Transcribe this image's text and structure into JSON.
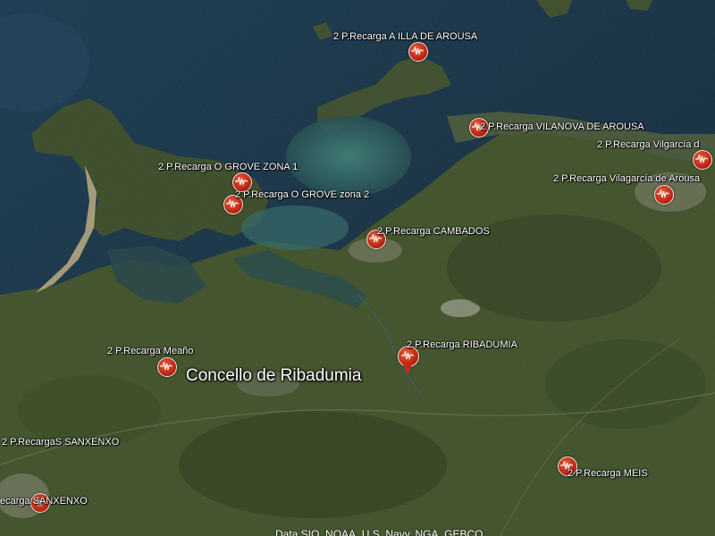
{
  "place_label": "Concello de Ribadumia",
  "credit": "Data SIO, NOAA, U.S. Navy, NGA, GEBCO",
  "icons": {
    "marker": "charging-station-marker-icon",
    "active_marker": "map-pin-icon"
  },
  "colors": {
    "marker": "#c42a14",
    "sea": "#0f2a45",
    "land": "#3d4e2a",
    "shallow": "#2f6e70"
  },
  "markers": [
    {
      "id": "a-illa",
      "label": "2 P.Recarga A ILLA DE AROUSA"
    },
    {
      "id": "vilanova",
      "label": "2 P.Recarga VILANOVA DE AROUSA"
    },
    {
      "id": "vilagarcia-1",
      "label": "2 P.Recarga Vilgarcía d"
    },
    {
      "id": "vilagarcia-2",
      "label": "2 P.Recarga Vilagarcía de Arousa"
    },
    {
      "id": "o-grove-1",
      "label": "2 P.Recarga O GROVE ZONA 1"
    },
    {
      "id": "o-grove-2",
      "label": "2 P.Recarga  O GROVE zona 2"
    },
    {
      "id": "cambados",
      "label": "2 P.Recarga CAMBADOS"
    },
    {
      "id": "ribadumia",
      "label": "2 P.Recarga RIBADUMIA"
    },
    {
      "id": "meano",
      "label": "2 P.Recarga Meaño"
    },
    {
      "id": "sanxenxo-1",
      "label": "2 P.RecargaS SANXENXO"
    },
    {
      "id": "sanxenxo-2",
      "label": "ecarga SANXENXO"
    },
    {
      "id": "meis",
      "label": "2 P.Recarga MEIS"
    }
  ]
}
